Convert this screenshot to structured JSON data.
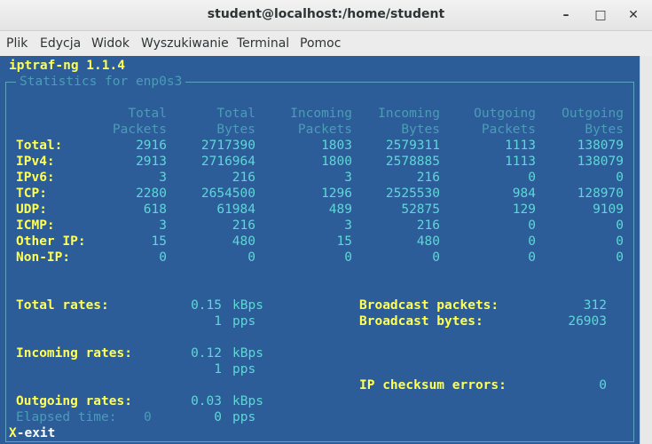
{
  "window": {
    "title": "student@localhost:/home/student"
  },
  "menu": [
    "Plik",
    "Edycja",
    "Widok",
    "Wyszukiwanie",
    "Terminal",
    "Pomoc"
  ],
  "app": {
    "title": "iptraf-ng 1.1.4",
    "frame_title": "Statistics for enp0s3"
  },
  "headers": [
    [
      "Total",
      "Packets"
    ],
    [
      "Total",
      "Bytes"
    ],
    [
      "Incoming",
      "Packets"
    ],
    [
      "Incoming",
      "Bytes"
    ],
    [
      "Outgoing",
      "Packets"
    ],
    [
      "Outgoing",
      "Bytes"
    ]
  ],
  "rows": [
    {
      "label": "Total:",
      "values": [
        "2916",
        "2717390",
        "1803",
        "2579311",
        "1113",
        "138079"
      ]
    },
    {
      "label": "IPv4:",
      "values": [
        "2913",
        "2716964",
        "1800",
        "2578885",
        "1113",
        "138079"
      ]
    },
    {
      "label": "IPv6:",
      "values": [
        "3",
        "216",
        "3",
        "216",
        "0",
        "0"
      ]
    },
    {
      "label": "TCP:",
      "values": [
        "2280",
        "2654500",
        "1296",
        "2525530",
        "984",
        "128970"
      ]
    },
    {
      "label": "UDP:",
      "values": [
        "618",
        "61984",
        "489",
        "52875",
        "129",
        "9109"
      ]
    },
    {
      "label": "ICMP:",
      "values": [
        "3",
        "216",
        "3",
        "216",
        "0",
        "0"
      ]
    },
    {
      "label": "Other IP:",
      "values": [
        "15",
        "480",
        "15",
        "480",
        "0",
        "0"
      ]
    },
    {
      "label": "Non-IP:",
      "values": [
        "0",
        "0",
        "0",
        "0",
        "0",
        "0"
      ]
    }
  ],
  "rates": {
    "total_label": "Total rates:",
    "total_kbps": "0.15",
    "total_pps": "1",
    "incoming_label": "Incoming rates:",
    "incoming_kbps": "0.12",
    "incoming_pps": "1",
    "outgoing_label": "Outgoing rates:",
    "outgoing_kbps": "0.03",
    "outgoing_pps": "0",
    "kbps_unit": "kBps",
    "pps_unit": "pps"
  },
  "broadcast": {
    "packets_label": "Broadcast packets:",
    "packets": "312",
    "bytes_label": "Broadcast bytes:",
    "bytes": "26903"
  },
  "checksum": {
    "label": "IP checksum errors:",
    "value": "0"
  },
  "elapsed": {
    "label": "Elapsed time:",
    "value": "0"
  },
  "footer": {
    "key": "X",
    "action": "-exit"
  }
}
